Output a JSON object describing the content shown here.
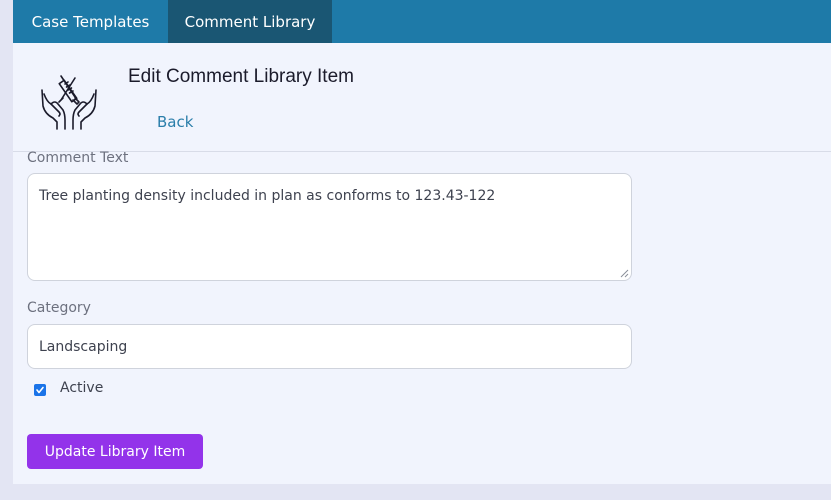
{
  "tabs": [
    {
      "label": "Case Templates",
      "active": false
    },
    {
      "label": "Comment Library",
      "active": true
    }
  ],
  "header": {
    "icon": "hands-with-tools-icon",
    "title": "Edit Comment Library Item",
    "back_label": "Back"
  },
  "form": {
    "comment_label": "Comment Text",
    "comment_value": "Tree planting density included in plan as conforms to 123.43-122",
    "category_label": "Category",
    "category_value": "Landscaping",
    "active_label": "Active",
    "active_checked": true,
    "submit_label": "Update Library Item"
  },
  "colors": {
    "tabbar": "#1e7aa8",
    "active_tab": "#1a5673",
    "link": "#2a7eaa",
    "submit": "#9333ea",
    "checkbox": "#1a73e8"
  }
}
